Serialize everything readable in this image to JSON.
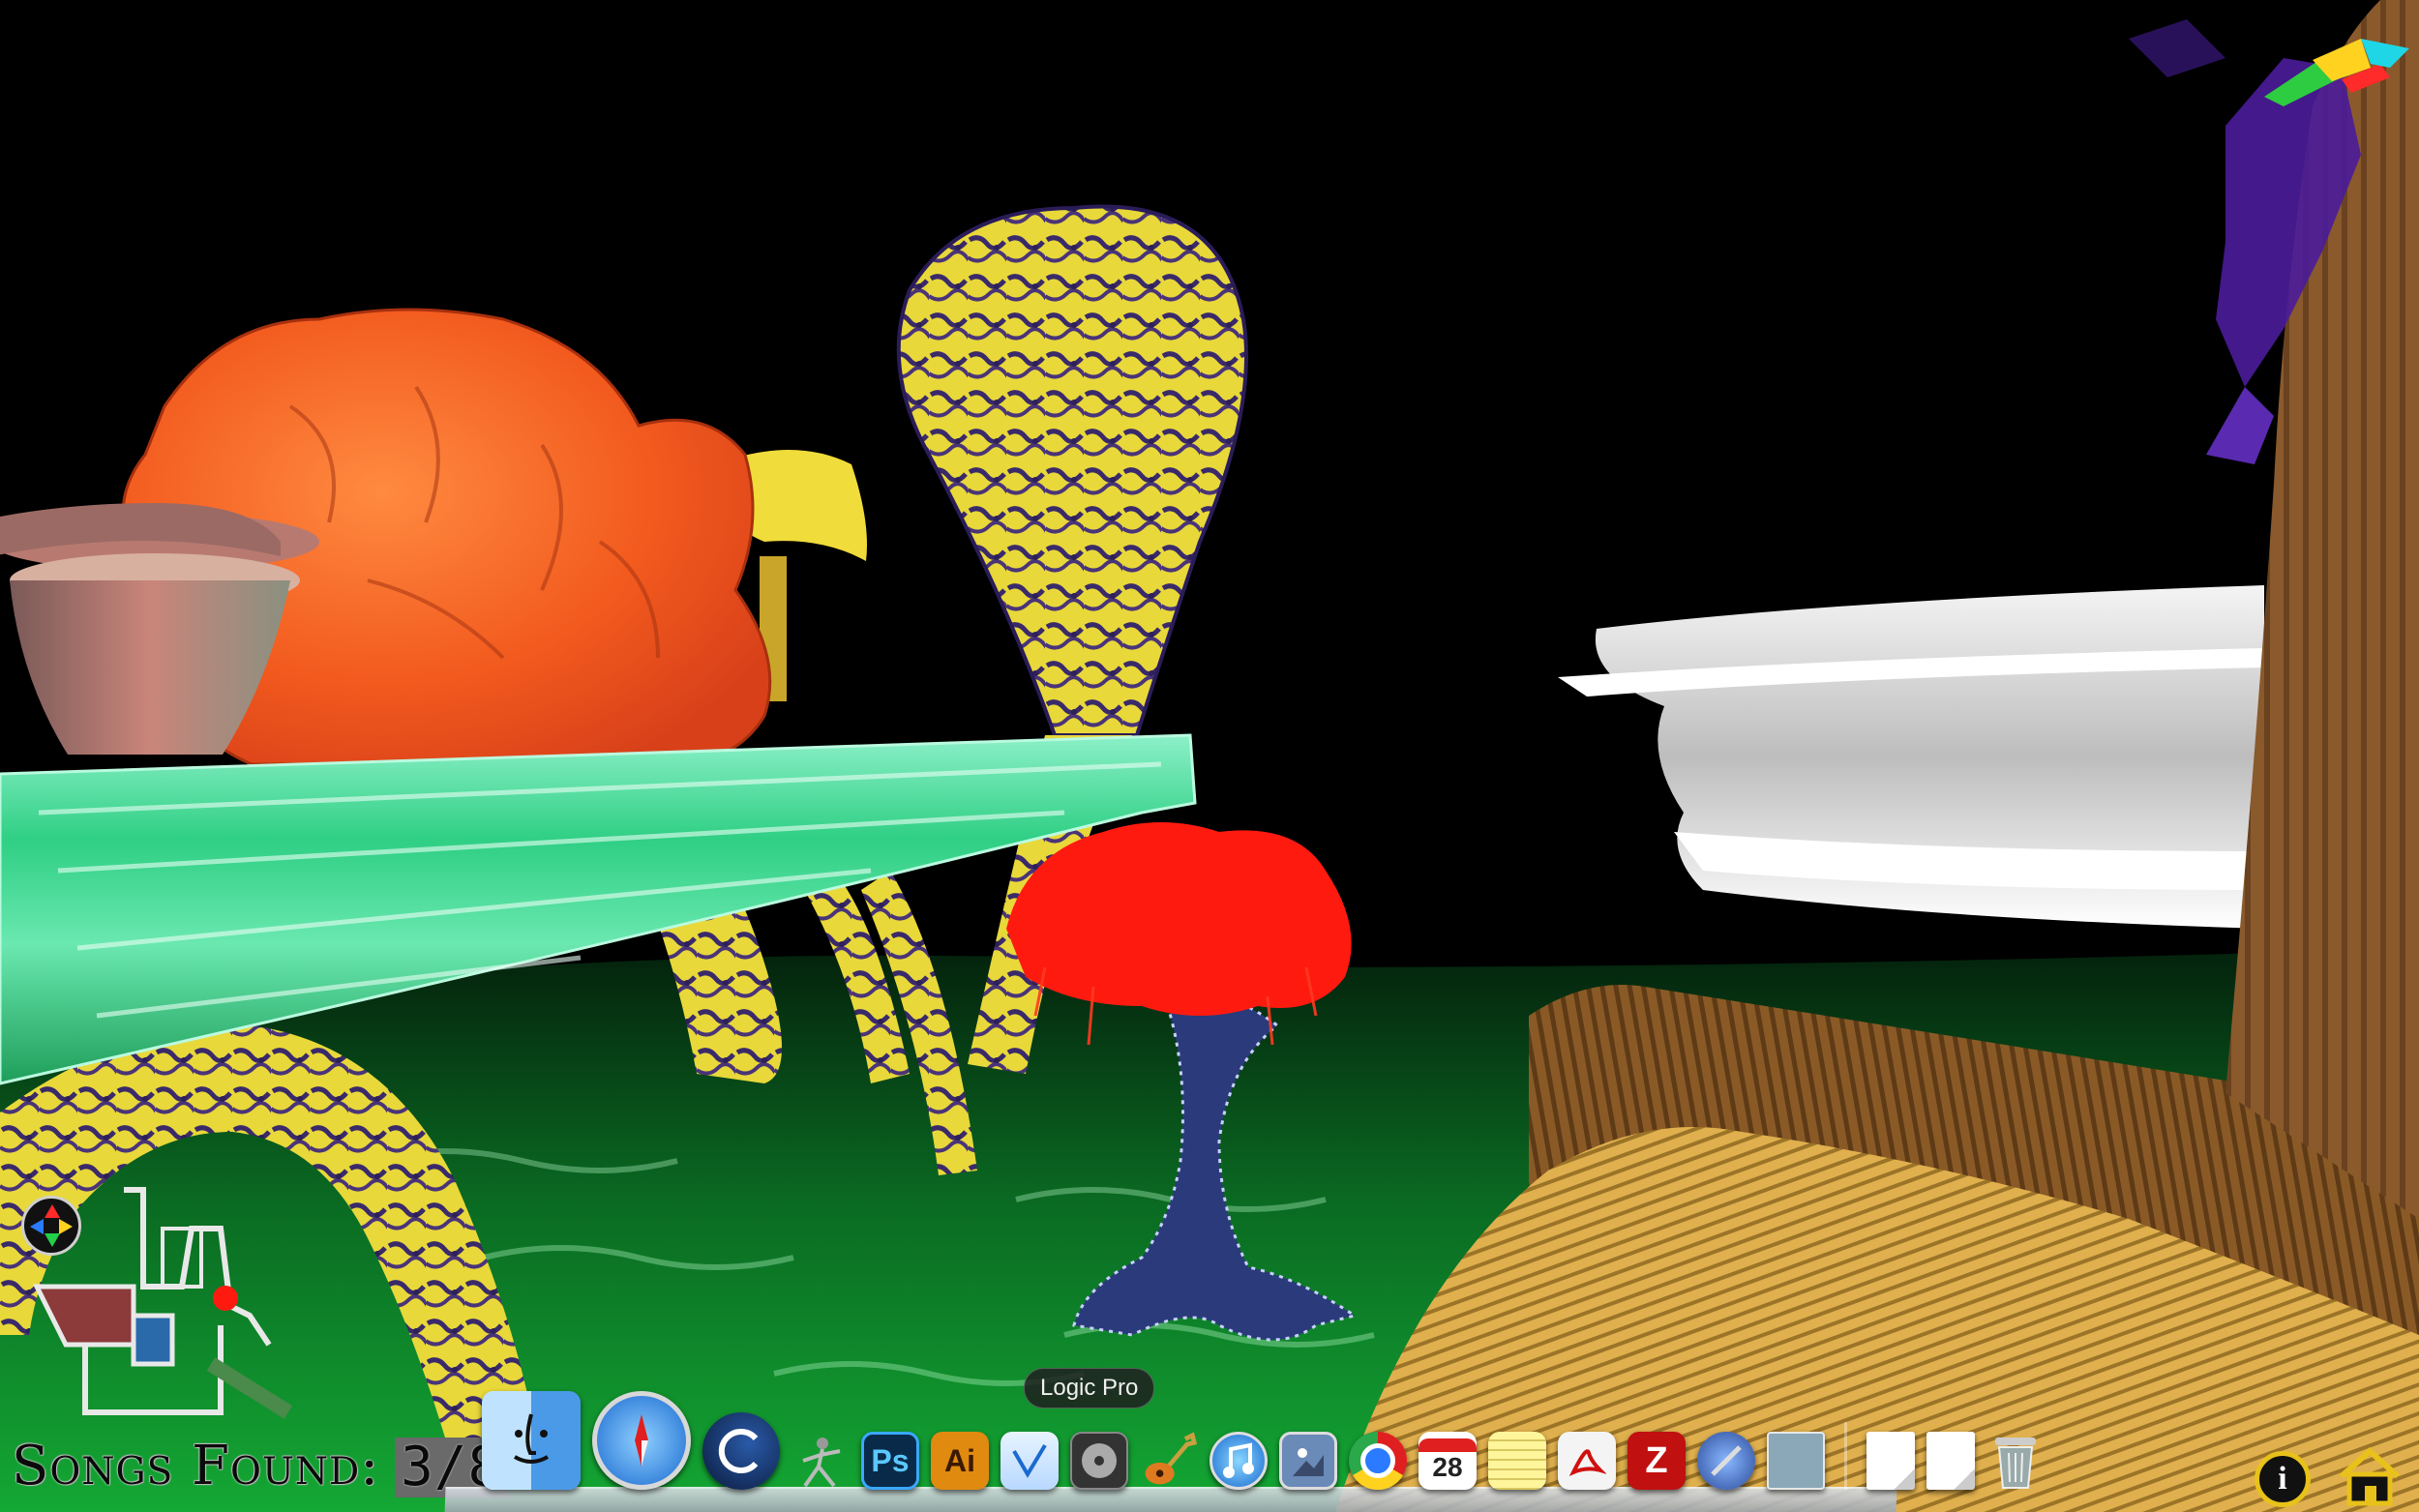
{
  "hud": {
    "songs_label": "Songs Found:",
    "songs_count": "3/8",
    "nav_pad_icon": "direction-pad-icon",
    "info_icon": "info-icon",
    "info_glyph": "i",
    "home_icon": "home-icon"
  },
  "dock": {
    "tooltip": "Logic Pro",
    "calendar_day": "28",
    "ps_label": "Ps",
    "ai_label": "Ai",
    "z_label": "Z",
    "items": [
      "finder-icon",
      "safari-icon",
      "cinema4d-icon",
      "zbrush-icon",
      "photoshop-icon",
      "illustrator-icon",
      "sketch-app-icon",
      "dvd-icon",
      "garageband-icon",
      "itunes-icon",
      "preview-icon",
      "chrome-icon",
      "calendar-icon",
      "notes-icon",
      "acrobat-icon",
      "filezilla-icon",
      "script-editor-icon",
      "document-thumb-icon",
      "blank-doc-icon",
      "blank-doc-icon-2",
      "trash-icon"
    ]
  },
  "colors": {
    "sky": "#000000",
    "ground": "#0c8a2a",
    "bridge": "#44d68a",
    "flower": "#f25a1e",
    "tree_canopy": "#ff1a10",
    "mushroom": "#f5e43a",
    "tree_trunk": "#7a4a1e",
    "basin": "#e0e0e0"
  }
}
